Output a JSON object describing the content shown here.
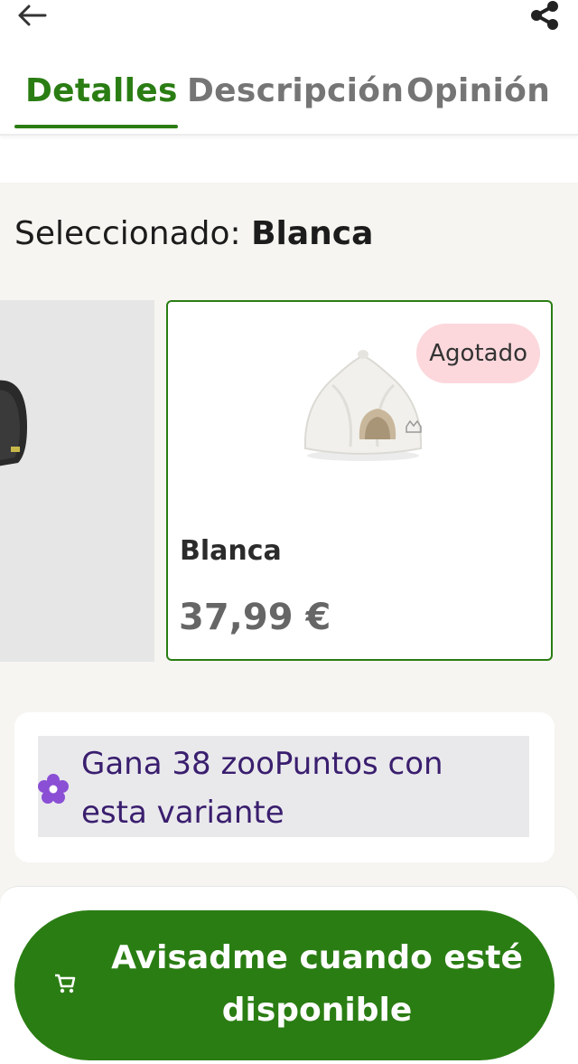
{
  "header": {
    "back_icon": "arrow-left-icon",
    "share_icon": "share-icon"
  },
  "tabs": [
    {
      "label": "Detalles",
      "active": true
    },
    {
      "label": "Descripción",
      "active": false
    },
    {
      "label": "Opinión",
      "active": false
    }
  ],
  "selection": {
    "prefix": "Seleccionado:",
    "value": "Blanca"
  },
  "variants": [
    {
      "name": "Blanca",
      "price": "37,99 €",
      "badge": "Agotado",
      "selected": true
    }
  ],
  "points": {
    "text": "Gana 38 zooPuntos con esta variante",
    "icon": "flower-badge-icon",
    "color": "#7a3fc4"
  },
  "footer": {
    "notify_label": "Avisadme cuando esté disponible",
    "cart_icon": "cart-icon"
  },
  "colors": {
    "accent": "#2a7d13",
    "badge_bg": "#fcd8dc",
    "points_text": "#3a1e6e"
  }
}
